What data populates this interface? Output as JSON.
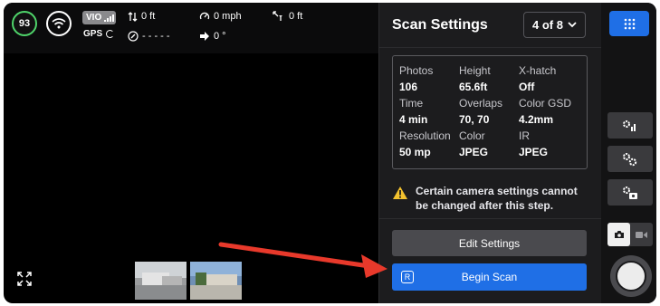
{
  "hud": {
    "battery": "93",
    "vio_label": "VIO",
    "gps_label": "GPS",
    "altitude": "0 ft",
    "speed": "0 mph",
    "distance": "0 ft",
    "compass": "- - - - -",
    "heading": "0 °"
  },
  "panel": {
    "title": "Scan Settings",
    "page_indicator": "4 of 8",
    "stats": [
      {
        "label": "Photos",
        "value": "106"
      },
      {
        "label": "Height",
        "value": "65.6ft"
      },
      {
        "label": "X-hatch",
        "value": "Off"
      },
      {
        "label": "Time",
        "value": "4 min"
      },
      {
        "label": "Overlaps",
        "value": "70, 70"
      },
      {
        "label": "Color GSD",
        "value": "4.2mm"
      },
      {
        "label": "Resolution",
        "value": "50 mp"
      },
      {
        "label": "Color",
        "value": "JPEG"
      },
      {
        "label": "IR",
        "value": "JPEG"
      }
    ],
    "warning": "Certain camera settings cannot be changed after this step.",
    "edit_button": "Edit Settings",
    "begin_button": "Begin Scan",
    "begin_key": "R"
  },
  "colors": {
    "accent": "#1f6fe6",
    "battery": "#4fd46a",
    "warning": "#f2c12e",
    "annotation_arrow": "#e8392b"
  },
  "icons": [
    "battery-ring",
    "wifi-icon",
    "signal-bars-icon",
    "altitude-icon",
    "speedometer-icon",
    "distance-icon",
    "compass-icon",
    "heading-icon",
    "expand-icon",
    "grid-menu-icon",
    "chevron-down-icon",
    "warning-icon",
    "camera-icon",
    "video-icon"
  ]
}
